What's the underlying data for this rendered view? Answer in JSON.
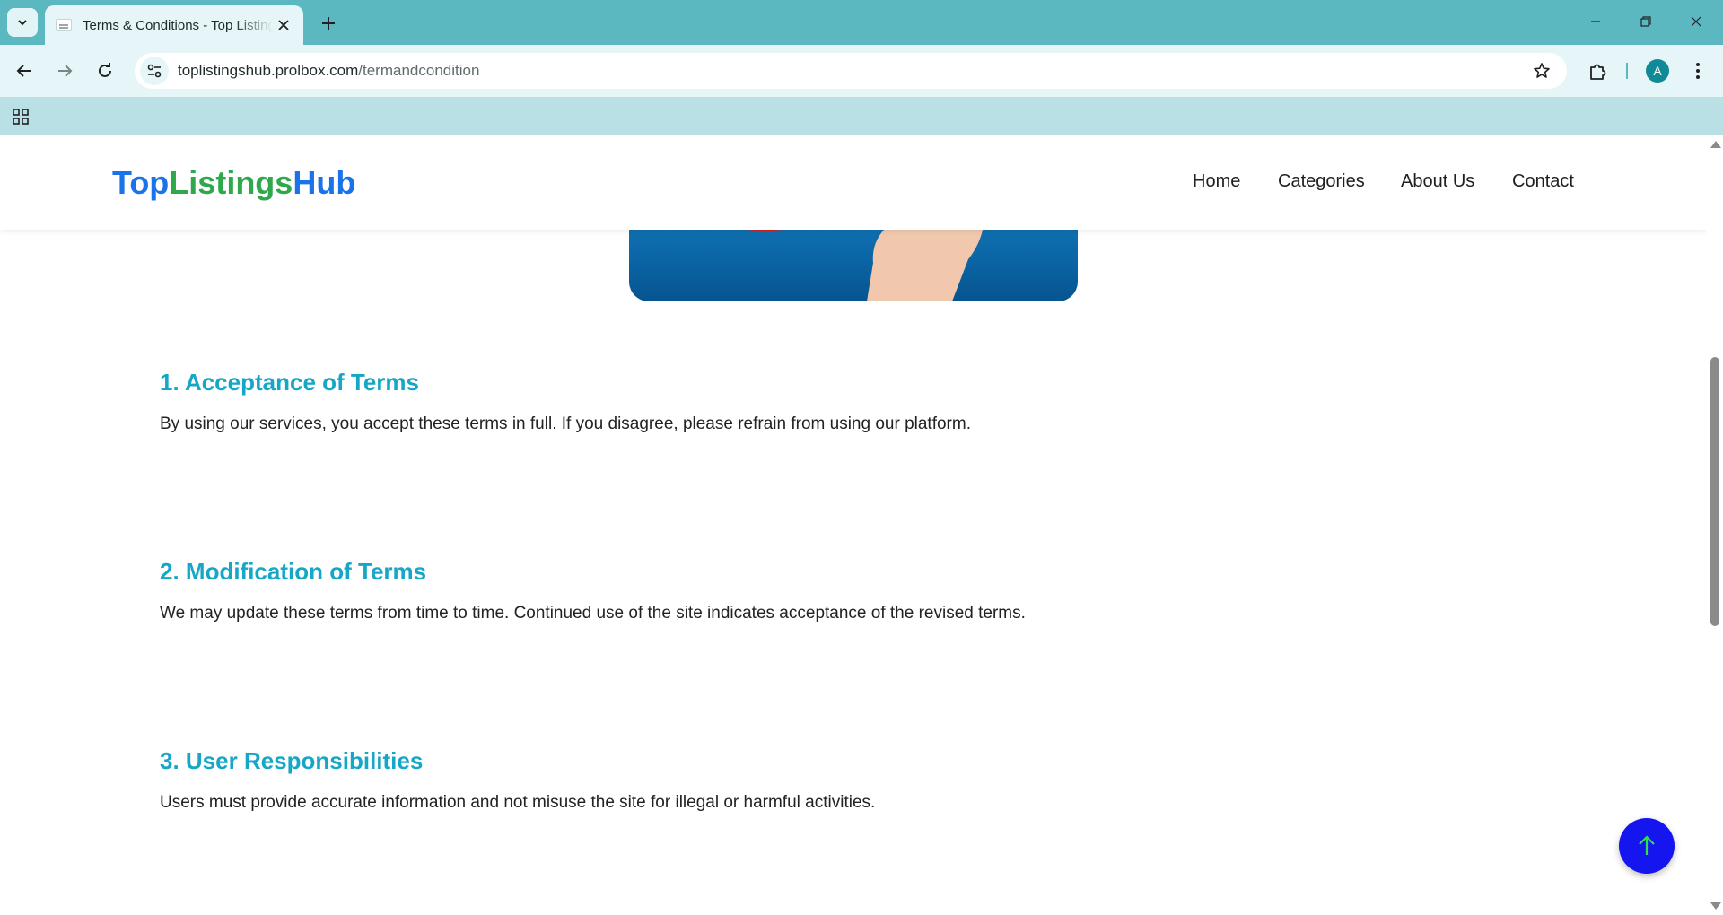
{
  "browser": {
    "tab_title": "Terms & Conditions - Top Listings Hub",
    "url_host": "toplistingshub.prolbox.com",
    "url_path": "/termandcondition",
    "profile_initial": "A",
    "icons": {
      "tab_search": "chevron-down-icon",
      "tab_close": "close-icon",
      "new_tab": "plus-icon",
      "back": "arrow-left-icon",
      "forward": "arrow-right-icon",
      "reload": "reload-icon",
      "site_info": "tune-icon",
      "bookmark": "star-icon",
      "extensions": "puzzle-icon",
      "menu": "kebab-menu-icon",
      "apps": "apps-grid-icon"
    },
    "chrome_color": "#5bb8c0"
  },
  "site": {
    "logo_part1": "Top",
    "logo_part2": "Listings",
    "logo_part3": "Hub",
    "nav": [
      "Home",
      "Categories",
      "About Us",
      "Contact"
    ],
    "colors": {
      "logo_blue": "#1a73e8",
      "logo_green": "#2ea84a",
      "heading_teal": "#17a7c6",
      "back_to_top": "#1515f0"
    }
  },
  "sections": [
    {
      "title": "1. Acceptance of Terms",
      "text": "By using our services, you accept these terms in full. If you disagree, please refrain from using our platform."
    },
    {
      "title": "2. Modification of Terms",
      "text": "We may update these terms from time to time. Continued use of the site indicates acceptance of the revised terms."
    },
    {
      "title": "3. User Responsibilities",
      "text": "Users must provide accurate information and not misuse the site for illegal or harmful activities."
    }
  ],
  "back_to_top_icon": "arrow-up-icon"
}
